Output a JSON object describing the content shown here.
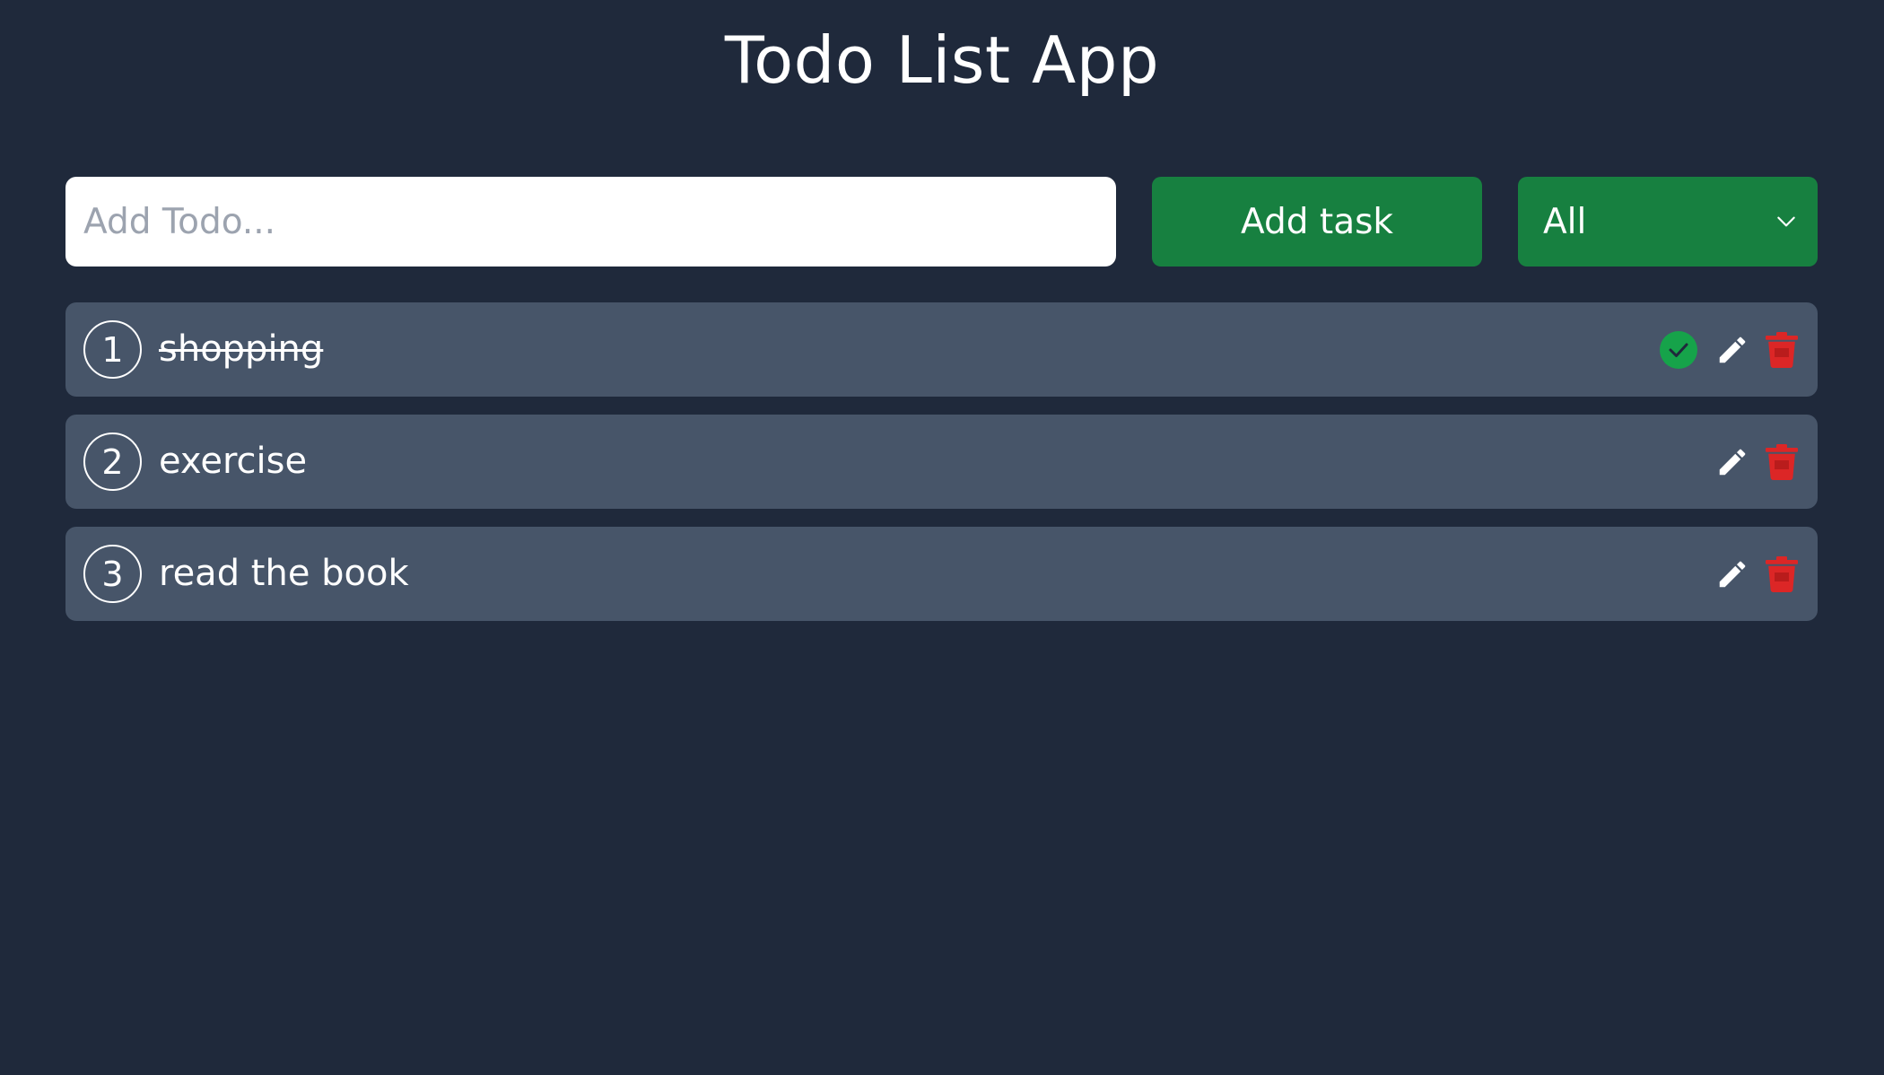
{
  "app": {
    "title": "Todo List App"
  },
  "form": {
    "input_placeholder": "Add Todo...",
    "input_value": "",
    "add_button_label": "Add task",
    "filter_selected": "All"
  },
  "todos": [
    {
      "number": "1",
      "text": "shopping",
      "completed": true
    },
    {
      "number": "2",
      "text": "exercise",
      "completed": false
    },
    {
      "number": "3",
      "text": "read the book",
      "completed": false
    }
  ],
  "icons": {
    "complete": "check-circle-icon",
    "edit": "pencil-icon",
    "delete": "trash-icon",
    "dropdown": "chevron-down-icon"
  },
  "colors": {
    "background": "#1f293b",
    "card": "#475569",
    "accent_green": "#178040",
    "check_green": "#16a34a",
    "delete_red": "#dc2626"
  }
}
